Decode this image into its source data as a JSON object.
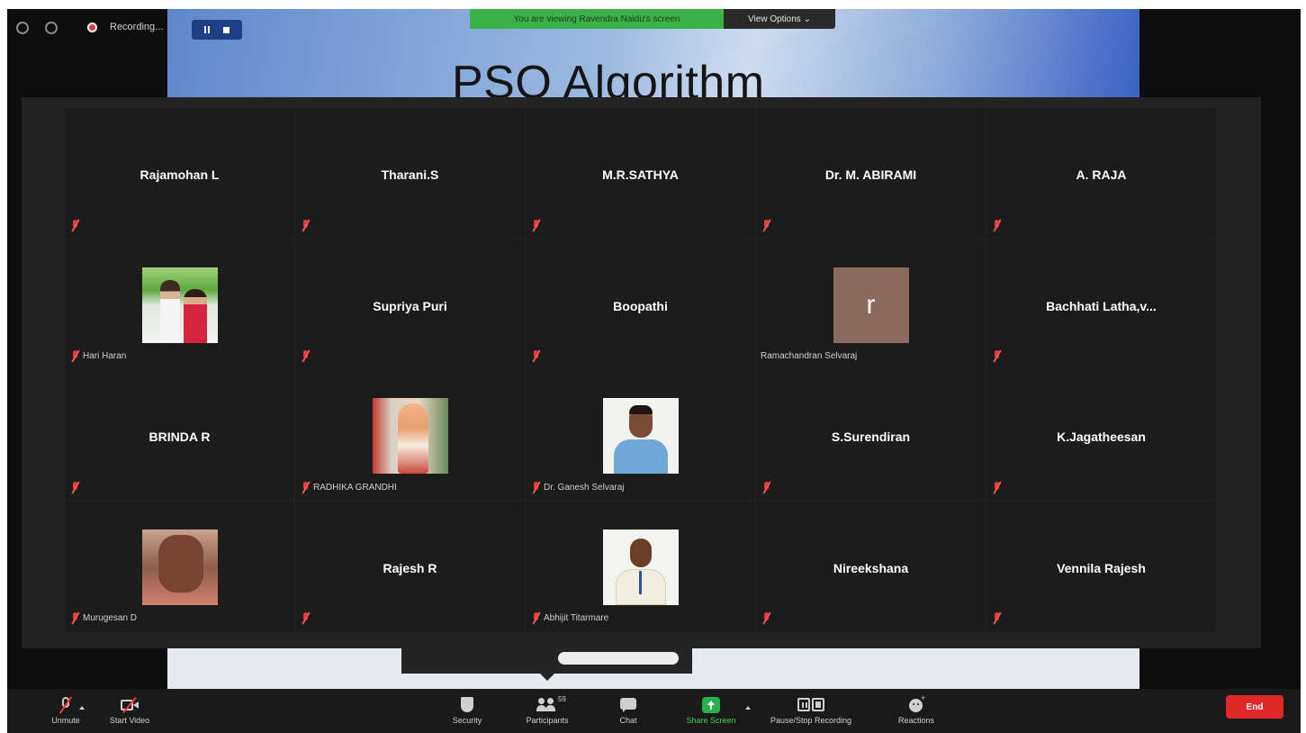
{
  "window": {
    "recording_label": "Recording...",
    "viewing_banner": "You are viewing Ravendra Naidu's screen",
    "view_options_label": "View Options ⌄"
  },
  "slide": {
    "title": "PSO Algorithm"
  },
  "participants": [
    {
      "name": "Rajamohan L",
      "video": "off"
    },
    {
      "name": "Tharani.S",
      "video": "off"
    },
    {
      "name": "M.R.SATHYA",
      "video": "off"
    },
    {
      "name": "Dr. M. ABIRAMI",
      "video": "off"
    },
    {
      "name": "A. RAJA",
      "video": "off"
    },
    {
      "name": "Hari Haran",
      "video": "photo",
      "avatar": "couple-photo"
    },
    {
      "name": "Supriya Puri",
      "video": "off"
    },
    {
      "name": "Boopathi",
      "video": "off"
    },
    {
      "name": "Ramachandran Selvaraj",
      "video": "photo",
      "avatar": "initial-r",
      "initial": "r"
    },
    {
      "name": "Bachhati  Latha,v...",
      "video": "off"
    },
    {
      "name": "BRINDA R",
      "video": "off"
    },
    {
      "name": "RADHIKA GRANDHI",
      "video": "photo",
      "avatar": "statue-photo"
    },
    {
      "name": "Dr. Ganesh Selvaraj",
      "video": "photo",
      "avatar": "man-photo"
    },
    {
      "name": "S.Surendiran",
      "video": "off"
    },
    {
      "name": "K.Jagatheesan",
      "video": "off"
    },
    {
      "name": "Murugesan D",
      "video": "photo",
      "avatar": "man-selfie-photo"
    },
    {
      "name": "Rajesh R",
      "video": "off"
    },
    {
      "name": "Abhijit Titarmare",
      "video": "photo",
      "avatar": "man-id-photo"
    },
    {
      "name": "Nireekshana",
      "video": "off"
    },
    {
      "name": "Vennila Rajesh",
      "video": "off"
    }
  ],
  "toolbar": {
    "unmute": "Unmute",
    "start_video": "Start Video",
    "security": "Security",
    "participants": "Participants",
    "participants_count": "59",
    "chat": "Chat",
    "share_screen": "Share Screen",
    "pause_stop_recording": "Pause/Stop Recording",
    "reactions": "Reactions",
    "end": "End"
  },
  "colors": {
    "muted_mic": "#e43b3b",
    "share_green": "#27b14a",
    "end_red": "#e02828",
    "banner_green": "#3bb14a",
    "recording_controls": "#1d3f86"
  }
}
